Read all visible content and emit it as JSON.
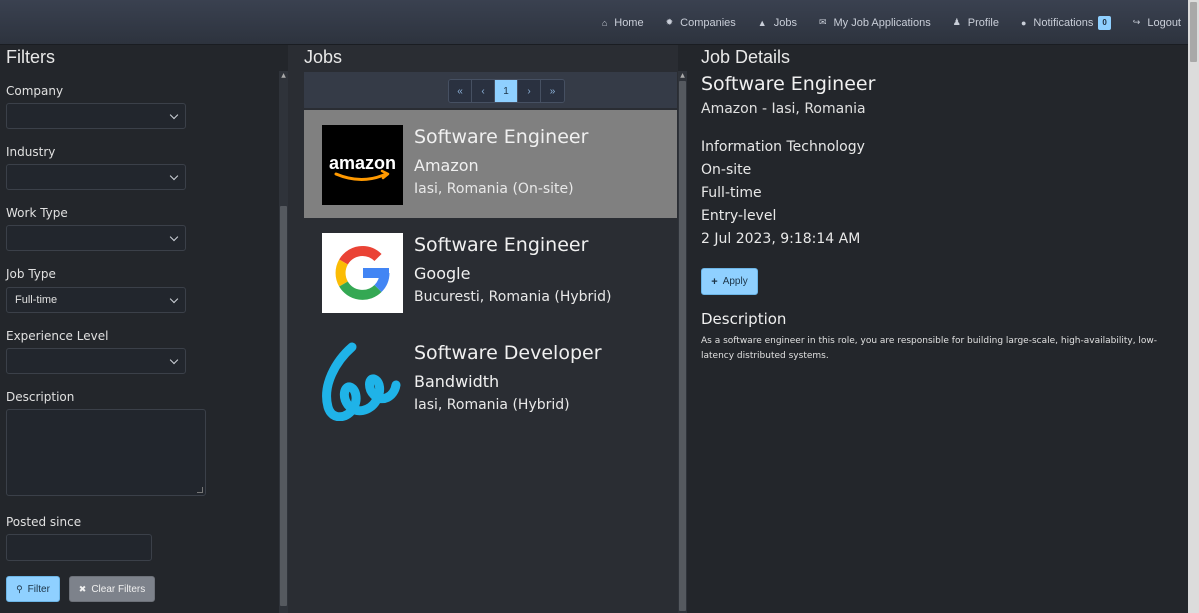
{
  "nav": {
    "items": [
      {
        "label": "Home",
        "icon": "home-icon"
      },
      {
        "label": "Companies",
        "icon": "companies-icon"
      },
      {
        "label": "Jobs",
        "icon": "jobs-icon"
      },
      {
        "label": "My Job Applications",
        "icon": "envelope-icon"
      },
      {
        "label": "Profile",
        "icon": "user-icon"
      },
      {
        "label": "Notifications",
        "icon": "bell-icon",
        "badge": "0"
      },
      {
        "label": "Logout",
        "icon": "logout-icon"
      }
    ]
  },
  "filters": {
    "title": "Filters",
    "company": {
      "label": "Company",
      "value": ""
    },
    "industry": {
      "label": "Industry",
      "value": ""
    },
    "work_type": {
      "label": "Work Type",
      "value": ""
    },
    "job_type": {
      "label": "Job Type",
      "value": "Full-time"
    },
    "experience_level": {
      "label": "Experience Level",
      "value": ""
    },
    "description": {
      "label": "Description",
      "value": ""
    },
    "posted_since": {
      "label": "Posted since",
      "value": ""
    },
    "filter_button": "Filter",
    "clear_button": "Clear Filters"
  },
  "jobs": {
    "title": "Jobs",
    "pagination": {
      "first": "«",
      "prev": "‹",
      "current": "1",
      "next": "›",
      "last": "»"
    },
    "list": [
      {
        "title": "Software Engineer",
        "company": "Amazon",
        "location": "Iasi, Romania (On-site)",
        "logo": "amazon-logo",
        "selected": true
      },
      {
        "title": "Software Engineer",
        "company": "Google",
        "location": "Bucuresti, Romania (Hybrid)",
        "logo": "google-logo",
        "selected": false
      },
      {
        "title": "Software Developer",
        "company": "Bandwidth",
        "location": "Iasi, Romania (Hybrid)",
        "logo": "bandwidth-logo",
        "selected": false
      }
    ]
  },
  "details": {
    "header": "Job Details",
    "title": "Software Engineer",
    "subtitle": "Amazon - Iasi, Romania",
    "industry": "Information Technology",
    "work_type": "On-site",
    "job_type": "Full-time",
    "experience": "Entry-level",
    "posted": "2 Jul 2023, 9:18:14 AM",
    "apply_button": "Apply",
    "description_heading": "Description",
    "description": "As a software engineer in this role, you are responsible for building large-scale, high-availability, low-latency distributed systems."
  },
  "colors": {
    "background": "#23262b",
    "navbar": "#343a46",
    "accent": "#8fd0ff",
    "selected_card": "#808080"
  }
}
